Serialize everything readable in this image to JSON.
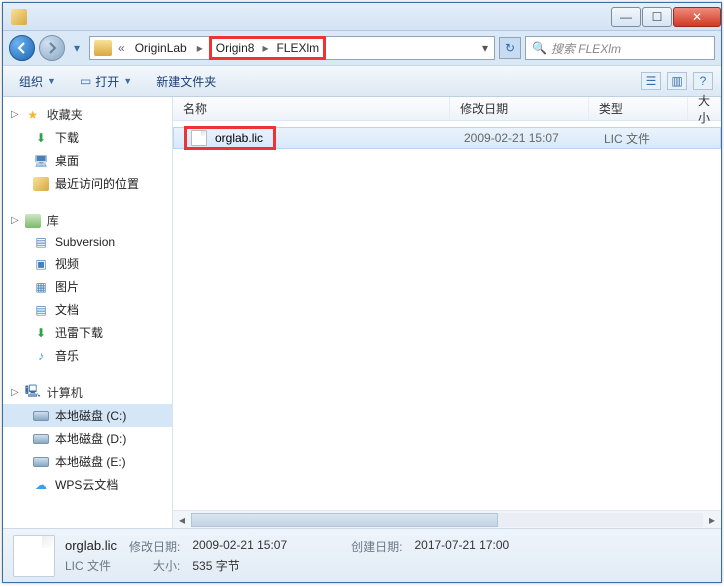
{
  "breadcrumb": {
    "prefix": "«",
    "items": [
      "OriginLab",
      "Origin8",
      "FLEXlm"
    ]
  },
  "search": {
    "placeholder": "搜索 FLEXlm"
  },
  "toolbar": {
    "organize": "组织",
    "open": "打开",
    "newfolder": "新建文件夹"
  },
  "sidebar": {
    "fav_header": "收藏夹",
    "fav_items": [
      "下载",
      "桌面",
      "最近访问的位置"
    ],
    "lib_header": "库",
    "lib_items": [
      "Subversion",
      "视频",
      "图片",
      "文档",
      "迅雷下载",
      "音乐"
    ],
    "comp_header": "计算机",
    "comp_items": [
      "本地磁盘 (C:)",
      "本地磁盘 (D:)",
      "本地磁盘 (E:)",
      "WPS云文档"
    ]
  },
  "columns": {
    "name": "名称",
    "date": "修改日期",
    "type": "类型",
    "size": "大小"
  },
  "files": [
    {
      "name": "orglab.lic",
      "date": "2009-02-21 15:07",
      "type": "LIC 文件"
    }
  ],
  "details": {
    "filename": "orglab.lic",
    "filetype": "LIC 文件",
    "mod_label": "修改日期:",
    "mod_value": "2009-02-21 15:07",
    "create_label": "创建日期:",
    "create_value": "2017-07-21 17:00",
    "size_label": "大小:",
    "size_value": "535 字节"
  }
}
